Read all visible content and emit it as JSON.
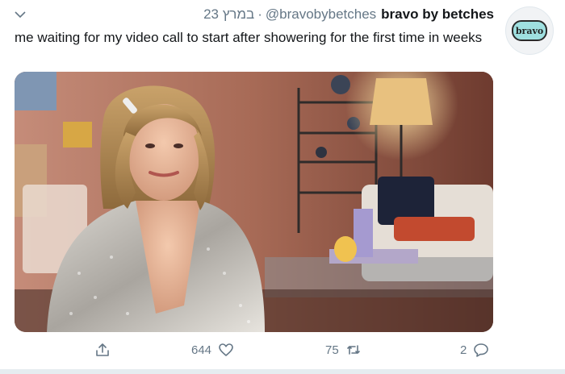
{
  "header": {
    "date": "23 במרץ",
    "handle": "@bravobybetches",
    "display_name": "bravo by betches"
  },
  "avatar": {
    "label": "bravo"
  },
  "tweet": {
    "text": "me waiting for my video call to start after showering for the first time in weeks"
  },
  "media": {
    "description_icon": "video-still-image"
  },
  "actions": {
    "likes": "644",
    "retweets": "75",
    "replies": "2"
  },
  "colors": {
    "text": "#14171a",
    "secondary": "#657786",
    "background": "#ffffff"
  }
}
